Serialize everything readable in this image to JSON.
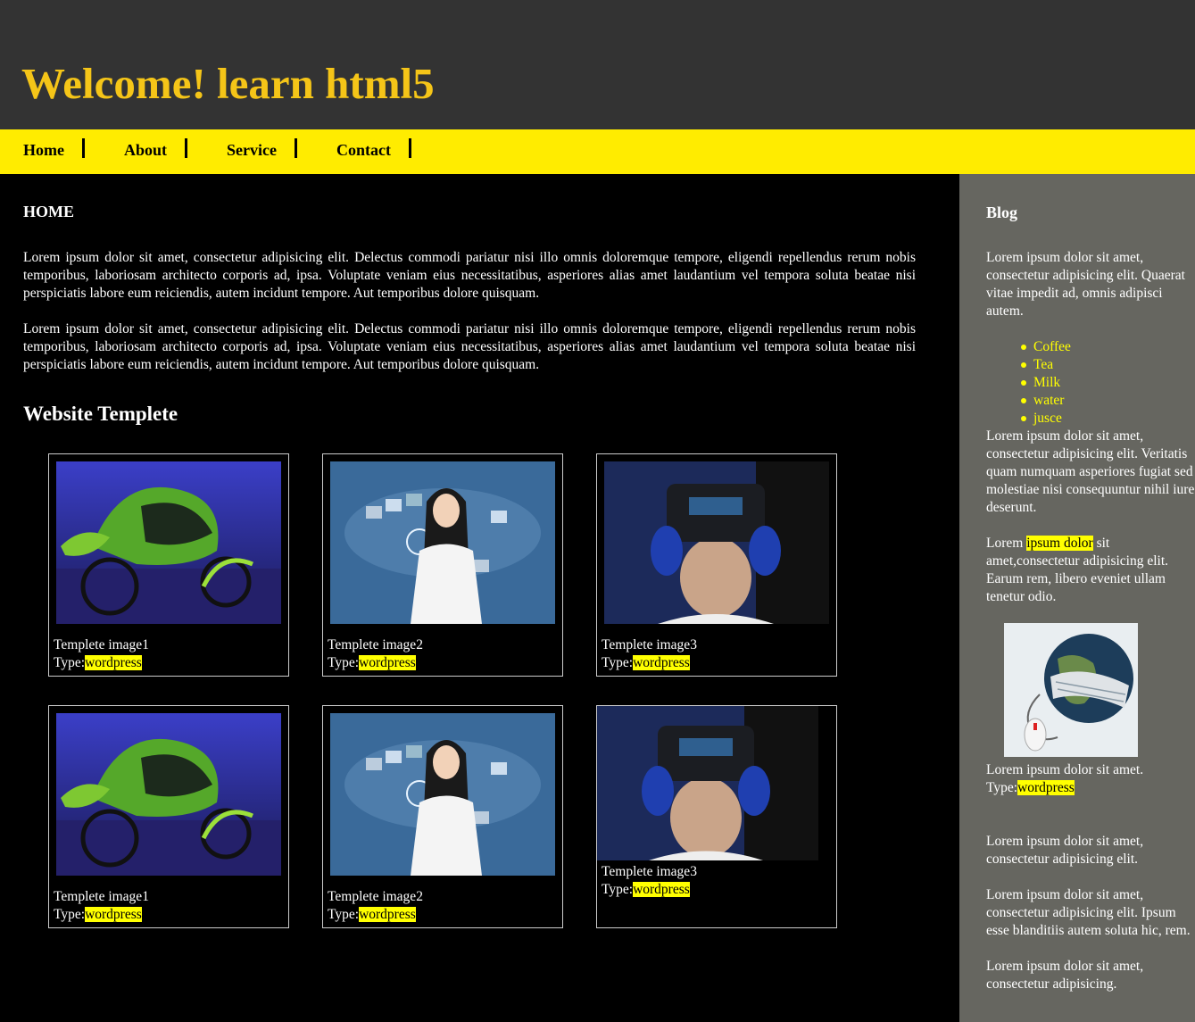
{
  "header": {
    "title": "Welcome! learn html5"
  },
  "nav": {
    "items": [
      "Home",
      "About",
      "Service",
      "Contact"
    ]
  },
  "main": {
    "section_title": "HOME",
    "paragraphs": [
      "Lorem ipsum dolor sit amet, consectetur adipisicing elit. Delectus commodi pariatur nisi illo omnis doloremque tempore, eligendi repellendus rerum nobis temporibus, laboriosam architecto corporis ad, ipsa. Voluptate veniam eius necessitatibus, asperiores alias amet laudantium vel tempora soluta beatae nisi perspiciatis labore eum reiciendis, autem incidunt tempore. Aut temporibus dolore quisquam.",
      "Lorem ipsum dolor sit amet, consectetur adipisicing elit. Delectus commodi pariatur nisi illo omnis doloremque tempore, eligendi repellendus rerum nobis temporibus, laboriosam architecto corporis ad, ipsa. Voluptate veniam eius necessitatibus, asperiores alias amet laudantium vel tempora soluta beatae nisi perspiciatis labore eum reiciendis, autem incidunt tempore. Aut temporibus dolore quisquam."
    ],
    "templates_title": "Website Templete",
    "templates": [
      {
        "name": "Templete image1",
        "type_label": "Type:",
        "type_value": "wordpress",
        "image": "green-bike"
      },
      {
        "name": "Templete image2",
        "type_label": "Type:",
        "type_value": "wordpress",
        "image": "woman-interface"
      },
      {
        "name": "Templete image3",
        "type_label": "Type:",
        "type_value": "wordpress",
        "image": "vr-headset"
      },
      {
        "name": "Templete image1",
        "type_label": "Type:",
        "type_value": "wordpress",
        "image": "green-bike"
      },
      {
        "name": "Templete image2",
        "type_label": "Type:",
        "type_value": "wordpress",
        "image": "woman-interface"
      },
      {
        "name": "Templete image3",
        "type_label": "Type:",
        "type_value": "wordpress",
        "image": "vr-headset"
      }
    ]
  },
  "sidebar": {
    "title": "Blog",
    "intro": "Lorem ipsum dolor sit amet, consectetur adipisicing elit. Quaerat vitae impedit ad, omnis adipisci autem.",
    "list": [
      "Coffee",
      "Tea",
      "Milk",
      "water",
      "jusce"
    ],
    "text2": "Lorem ipsum dolor sit amet, consectetur adipisicing elit. Veritatis quam numquam asperiores fugiat sed molestiae nisi consequuntur nihil iure deserunt.",
    "text3_pre": "Lorem ",
    "text3_highlight": "ipsum dolor",
    "text3_post": " sit amet,consectetur adipisicing elit. Earum rem, libero eveniet ullam tenetur odio.",
    "image": "globe-keyboard-mouse",
    "caption": "Lorem ipsum dolor sit amet.",
    "caption_type_label": "Type:",
    "caption_type_value": "wordpress",
    "text4": "Lorem ipsum dolor sit amet, consectetur adipisicing elit.",
    "text5": "Lorem ipsum dolor sit amet, consectetur adipisicing elit. Ipsum esse blanditiis autem soluta hic, rem.",
    "text6": "Lorem ipsum dolor sit amet, consectetur adipisicing."
  },
  "colors": {
    "header_bg": "#333333",
    "title": "#f5c518",
    "nav_bg": "#ffec00",
    "sidebar_bg": "#666660",
    "highlight": "#ffff00"
  }
}
